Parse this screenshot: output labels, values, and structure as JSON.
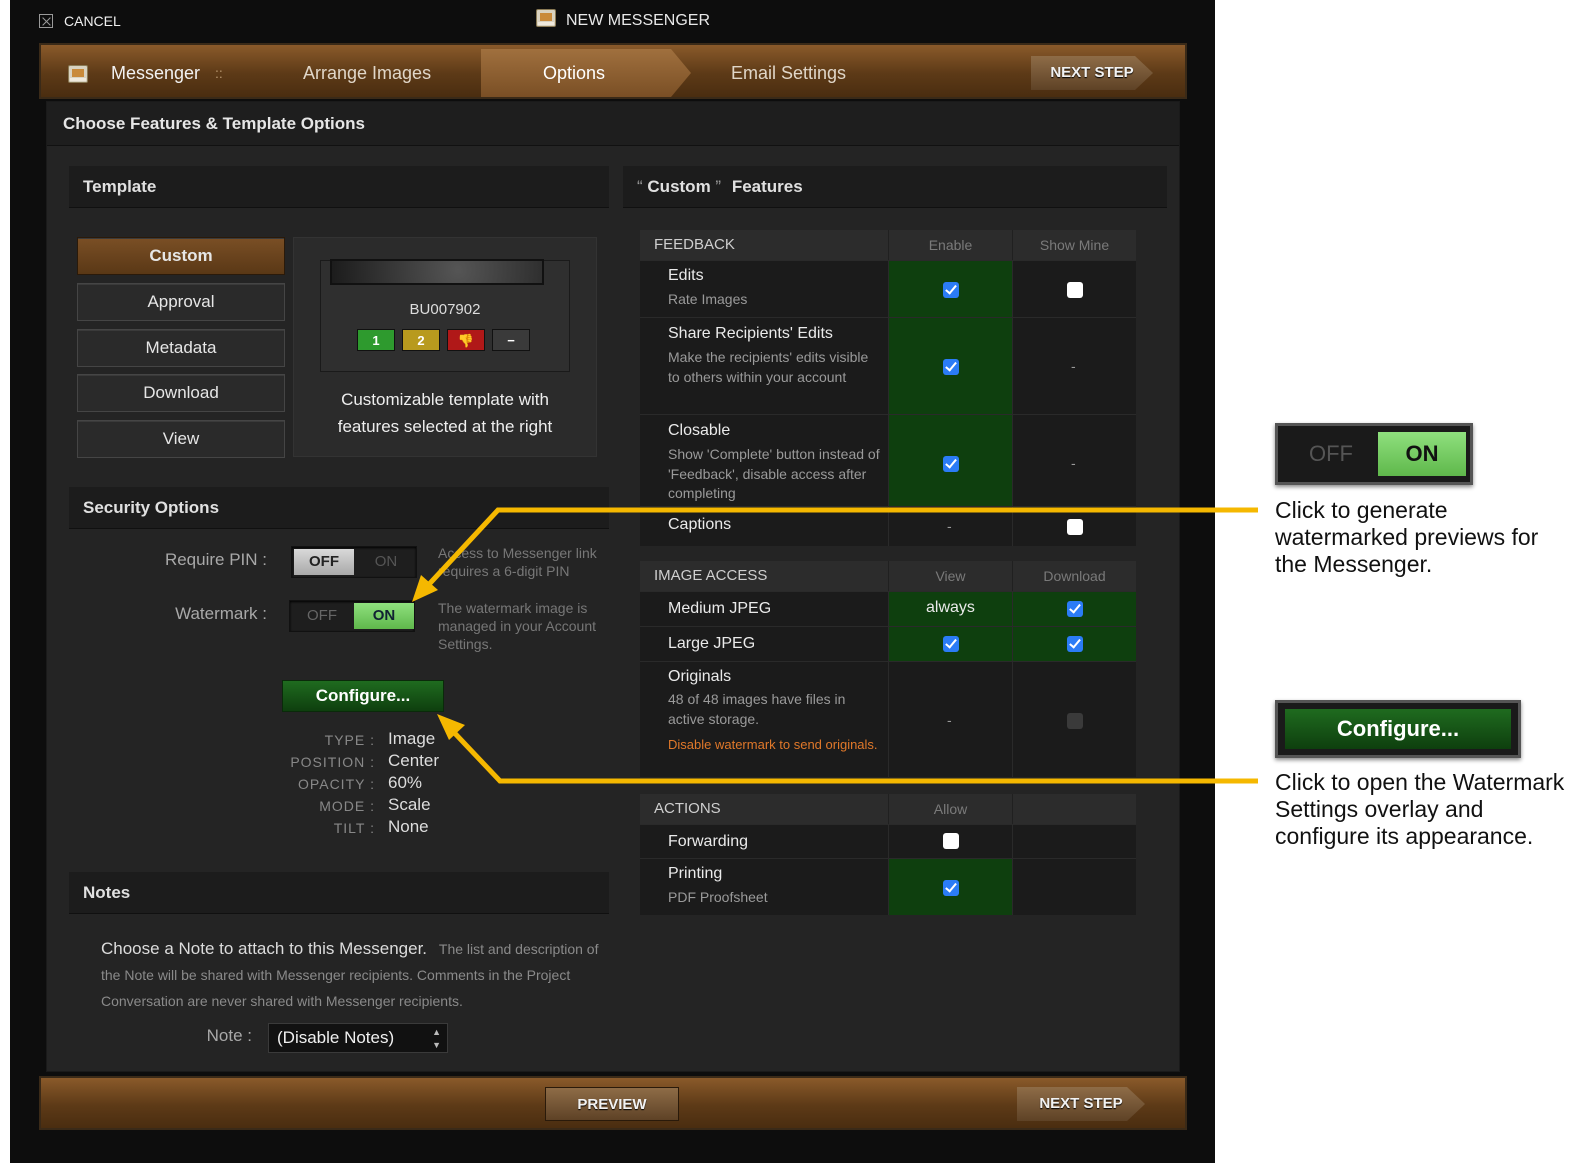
{
  "topbar": {
    "cancel_label": "CANCEL",
    "title": "NEW MESSENGER"
  },
  "wizard": {
    "app_name": "Messenger",
    "separator": "::",
    "steps": [
      "Arrange Images",
      "Options",
      "Email Settings"
    ],
    "active_step": "Options",
    "next_label": "NEXT STEP"
  },
  "page_title": "Choose Features & Template Options",
  "template": {
    "heading": "Template",
    "options": [
      "Custom",
      "Approval",
      "Metadata",
      "Download",
      "View"
    ],
    "selected": "Custom",
    "preview_id": "BU007902",
    "rating_buttons": [
      "1",
      "2",
      "👎",
      "−"
    ],
    "description_line1": "Customizable template with",
    "description_line2": "features selected at the right"
  },
  "security": {
    "heading": "Security Options",
    "pin_label": "Require PIN :",
    "pin_off": "OFF",
    "pin_on": "ON",
    "pin_hint": "Access to Messenger link requires a 6-digit PIN",
    "watermark_label": "Watermark :",
    "wm_off": "OFF",
    "wm_on": "ON",
    "wm_hint": "The watermark image is managed in your Account Settings.",
    "configure_label": "Configure...",
    "wm_details": [
      {
        "k": "TYPE :",
        "v": "Image"
      },
      {
        "k": "POSITION :",
        "v": "Center"
      },
      {
        "k": "OPACITY :",
        "v": "60%"
      },
      {
        "k": "MODE :",
        "v": "Scale"
      },
      {
        "k": "TILT :",
        "v": "None"
      }
    ]
  },
  "notes": {
    "heading": "Notes",
    "lead": "Choose a Note to attach to this Messenger.",
    "description": "The list and description of the Note will be shared with Messenger recipients. Comments in the Project Conversation are never shared with Messenger recipients.",
    "note_label": "Note :",
    "selected": "(Disable Notes)"
  },
  "features": {
    "heading_quote_open": "“",
    "heading_name": "Custom",
    "heading_quote_close": "”",
    "heading_suffix": "Features",
    "feedback": {
      "title": "FEEDBACK",
      "col1": "Enable",
      "col2": "Show Mine",
      "edits_t": "Edits",
      "edits_d": "Rate Images",
      "share_t": "Share Recipients' Edits",
      "share_d": "Make the recipients' edits visible to others within your account",
      "close_t": "Closable",
      "close_d": "Show 'Complete' button instead of 'Feedback', disable access after completing",
      "captions_t": "Captions",
      "dash": "-"
    },
    "image_access": {
      "title": "IMAGE ACCESS",
      "col1": "View",
      "col2": "Download",
      "medium": "Medium JPEG",
      "always": "always",
      "large": "Large JPEG",
      "orig_t": "Originals",
      "orig_d": "48 of 48 images have files in active storage.",
      "orig_warn": "Disable watermark to send originals.",
      "dash": "-"
    },
    "actions": {
      "title": "ACTIONS",
      "col1": "Allow",
      "forwarding": "Forwarding",
      "print_t": "Printing",
      "print_d": "PDF Proofsheet"
    }
  },
  "footer": {
    "preview_label": "PREVIEW",
    "next_label": "NEXT STEP"
  },
  "callouts": {
    "toggle_off": "OFF",
    "toggle_on": "ON",
    "toggle_text": "Click to generate watermarked previews for the Messenger.",
    "configure_label": "Configure...",
    "configure_text": "Click to open the Watermark Settings overlay and configure its appearance."
  },
  "colors": {
    "accent_orange": "#e0782a",
    "enabled_green": "#0e3f0e",
    "arrow_yellow": "#f5b800"
  }
}
